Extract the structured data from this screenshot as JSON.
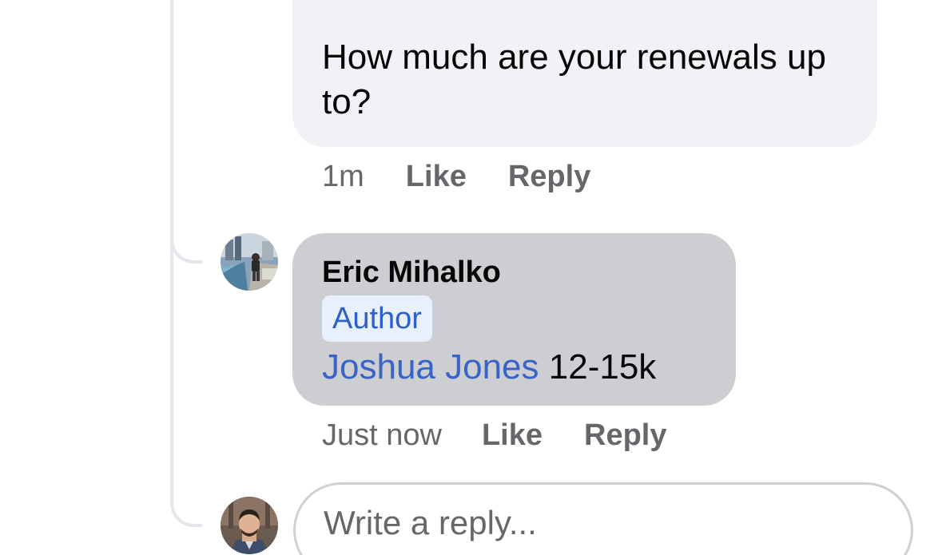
{
  "previous_comment": {
    "text": "How much are your renewals up to?",
    "time": "1m",
    "like_label": "Like",
    "reply_label": "Reply"
  },
  "reply_comment": {
    "author": "Eric Mihalko",
    "badge": "Author",
    "mention": "Joshua Jones",
    "text": "12-15k",
    "time": "Just now",
    "like_label": "Like",
    "reply_label": "Reply"
  },
  "composer": {
    "placeholder": "Write a reply..."
  },
  "colors": {
    "bubble_default": "#f0f2f5",
    "bubble_highlight": "#ccced2",
    "mention": "#3a63c8",
    "badge_bg": "#e7f0fc",
    "secondary_text": "#65676b"
  }
}
